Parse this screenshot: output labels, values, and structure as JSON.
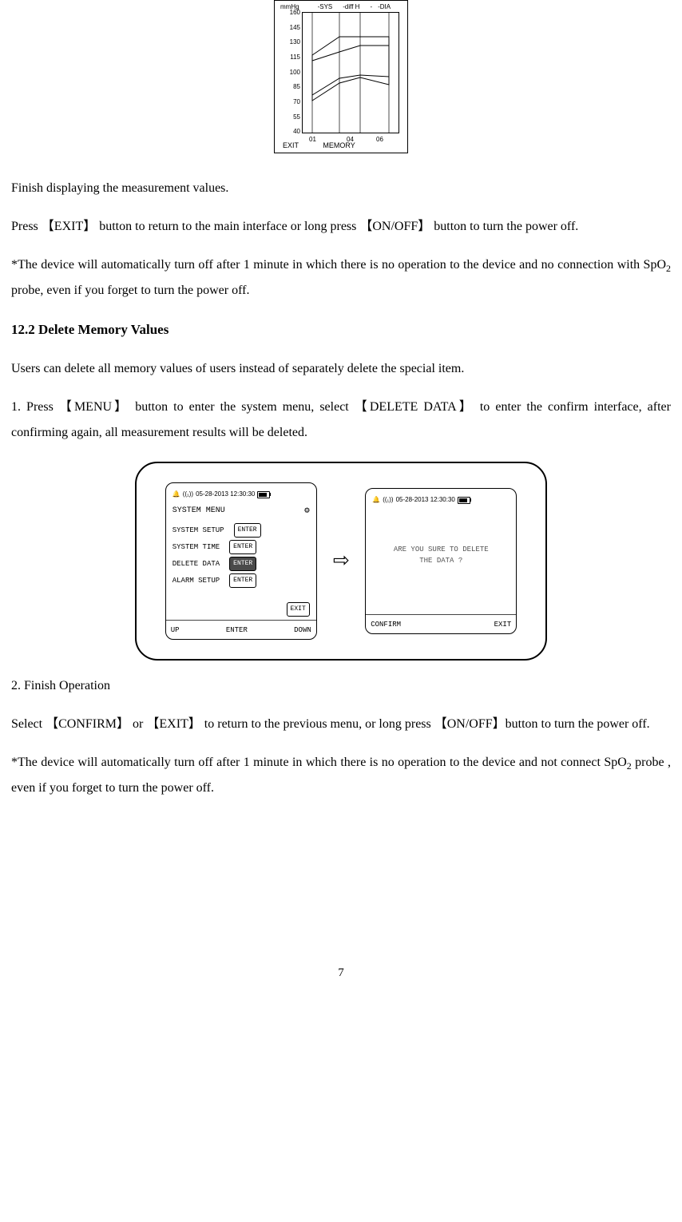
{
  "chart_data": {
    "type": "line",
    "ylabel": "mmHg",
    "categories": [
      "01",
      "04",
      "06"
    ],
    "yticks": [
      40,
      55,
      70,
      85,
      100,
      115,
      130,
      145,
      160
    ],
    "series": [
      {
        "name": "-SYS",
        "values": [
          118,
          136,
          136
        ]
      },
      {
        "name": "-diff H",
        "values": [
          112,
          121,
          127
        ]
      },
      {
        "name": "-",
        "values": [
          78,
          95,
          97
        ]
      },
      {
        "name": "-DIA",
        "values": [
          72,
          80,
          88
        ]
      }
    ],
    "footer_left": "EXIT",
    "footer_right": "MEMORY"
  },
  "para1": "Finish displaying the measurement values.",
  "para2a": "Press 【",
  "para2b": "EXIT",
  "para2c": "】 button to return to the main interface or long press 【",
  "para2d": "ON/OFF",
  "para2e": "】 button to turn the power off.",
  "para3a": "*The device will automatically turn off after 1 minute in which there is no operation to the device and no connection with SpO",
  "para3b": " probe, even if you forget to turn the power off.",
  "h2": "12.2 Delete Memory Values",
  "para4": "Users can delete all memory values of users instead of separately delete the special item.",
  "para5a": "1.  Press 【",
  "para5b": "MENU",
  "para5c": "】 button to enter the system menu, select 【",
  "para5d": "DELETE DATA",
  "para5e": "】 to enter the confirm interface, after confirming again, all measurement results will be deleted.",
  "device": {
    "timestamp": "05-28-2013  12:30:30",
    "menu_title": "SYSTEM MENU",
    "rows": [
      {
        "label": "SYSTEM SETUP",
        "btn": "ENTER",
        "sel": false
      },
      {
        "label": "SYSTEM TIME",
        "btn": "ENTER",
        "sel": false
      },
      {
        "label": "DELETE DATA",
        "btn": "ENTER",
        "sel": true
      },
      {
        "label": "ALARM SETUP",
        "btn": "ENTER",
        "sel": false
      }
    ],
    "exit": "EXIT",
    "soft_left": [
      "UP",
      "ENTER",
      "DOWN"
    ],
    "confirm_msg_1": "ARE YOU SURE TO DELETE",
    "confirm_msg_2": "THE DATA ?",
    "soft_right": [
      "CONFIRM",
      "EXIT"
    ]
  },
  "para6": "2. Finish Operation",
  "para7a": "Select 【",
  "para7b": "CONFIRM",
  "para7c": "】 or 【",
  "para7d": "EXIT",
  "para7e": "】 to return to the previous menu, or long press 【",
  "para7f": "ON/OFF",
  "para7g": "】button to turn the power off.",
  "para8a": "*The device will automatically turn off after 1 minute in which there is no operation to the device and not connect SpO",
  "para8b": " probe , even if you forget to turn the power off.",
  "page": "7"
}
